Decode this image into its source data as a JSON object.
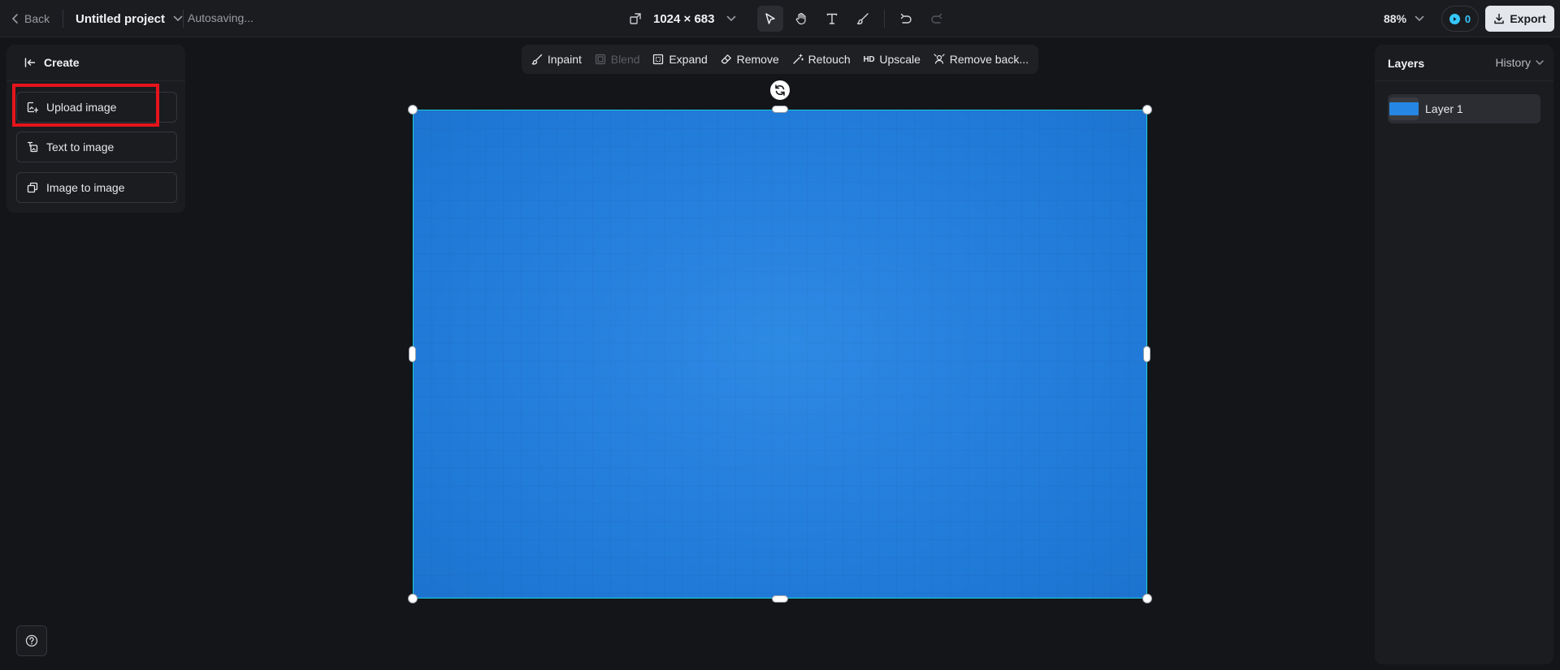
{
  "topbar": {
    "back_label": "Back",
    "project_name": "Untitled project",
    "autosave_status": "Autosaving...",
    "canvas_size": "1024 × 683",
    "zoom": "88%",
    "credits": "0",
    "export_label": "Export"
  },
  "tools": [
    {
      "name": "select-tool",
      "icon": "cursor-icon",
      "active": true
    },
    {
      "name": "pan-tool",
      "icon": "hand-icon",
      "active": false
    },
    {
      "name": "text-tool",
      "icon": "text-icon",
      "active": false
    },
    {
      "name": "brush-tool",
      "icon": "brush-icon",
      "active": false
    }
  ],
  "left_panel": {
    "header": "Create",
    "items": [
      {
        "label": "Upload image",
        "icon": "upload-image-icon",
        "highlighted": true
      },
      {
        "label": "Text to image",
        "icon": "text-to-image-icon"
      },
      {
        "label": "Image to image",
        "icon": "image-to-image-icon"
      }
    ]
  },
  "edit_toolbar": {
    "items": [
      {
        "label": "Inpaint",
        "icon": "inpaint-icon",
        "enabled": true
      },
      {
        "label": "Blend",
        "icon": "blend-icon",
        "enabled": false
      },
      {
        "label": "Expand",
        "icon": "expand-icon",
        "enabled": true
      },
      {
        "label": "Remove",
        "icon": "eraser-icon",
        "enabled": true
      },
      {
        "label": "Retouch",
        "icon": "retouch-icon",
        "enabled": true
      },
      {
        "label": "Upscale",
        "icon": "hd-icon",
        "prefix": "HD",
        "enabled": true
      },
      {
        "label": "Remove back...",
        "icon": "remove-background-icon",
        "enabled": true
      }
    ]
  },
  "canvas": {
    "image_color": "#2587e3",
    "selection_color": "#19d3e0"
  },
  "right_panel": {
    "title": "Layers",
    "history_label": "History",
    "layers": [
      {
        "label": "Layer 1"
      }
    ]
  },
  "colors": {
    "background": "#141519",
    "panel": "#1b1c20",
    "accent": "#35c7ff",
    "highlight": "#e5141b"
  }
}
